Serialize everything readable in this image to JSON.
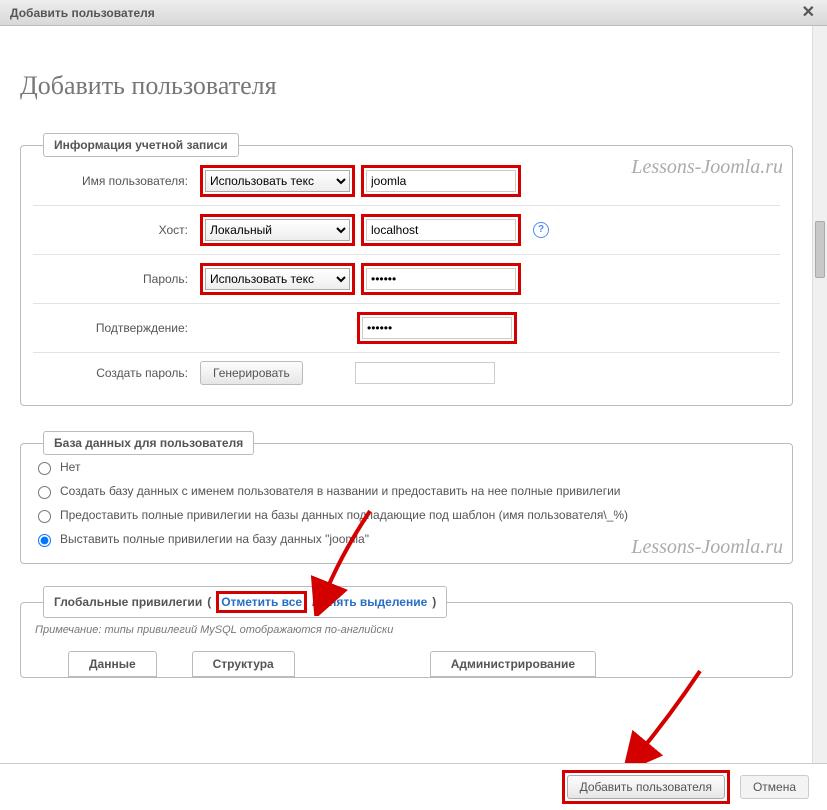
{
  "dialog": {
    "title": "Добавить пользователя"
  },
  "page_title": "Добавить пользователя",
  "watermark": "Lessons-Joomla.ru",
  "fs_account": {
    "legend": "Информация учетной записи",
    "username_label": "Имя пользователя:",
    "username_select": "Использовать текс",
    "username_value": "joomla",
    "host_label": "Хост:",
    "host_select": "Локальный",
    "host_value": "localhost",
    "password_label": "Пароль:",
    "password_select": "Использовать текс",
    "password_value": "••••••",
    "confirm_label": "Подтверждение:",
    "confirm_value": "••••••",
    "gen_label": "Создать пароль:",
    "gen_button": "Генерировать"
  },
  "fs_db": {
    "legend": "База данных для пользователя",
    "opt_none": "Нет",
    "opt_create": "Создать базу данных с именем пользователя в названии и предоставить на нее полные привилегии",
    "opt_wildcard": "Предоставить полные привилегии на базы данных подпадающие под шаблон (имя пользователя\\_%)",
    "opt_all": "Выставить полные привилегии на базу данных \"joomla\""
  },
  "fs_priv": {
    "legend": "Глобальные привилегии",
    "check_all": "Отметить все",
    "uncheck_all": "Снять выделение",
    "note": "Примечание: типы привилегий MySQL отображаются по-английски",
    "tab_data": "Данные",
    "tab_struct": "Структура",
    "tab_admin": "Администрирование"
  },
  "footer": {
    "submit": "Добавить пользователя",
    "cancel": "Отмена"
  }
}
